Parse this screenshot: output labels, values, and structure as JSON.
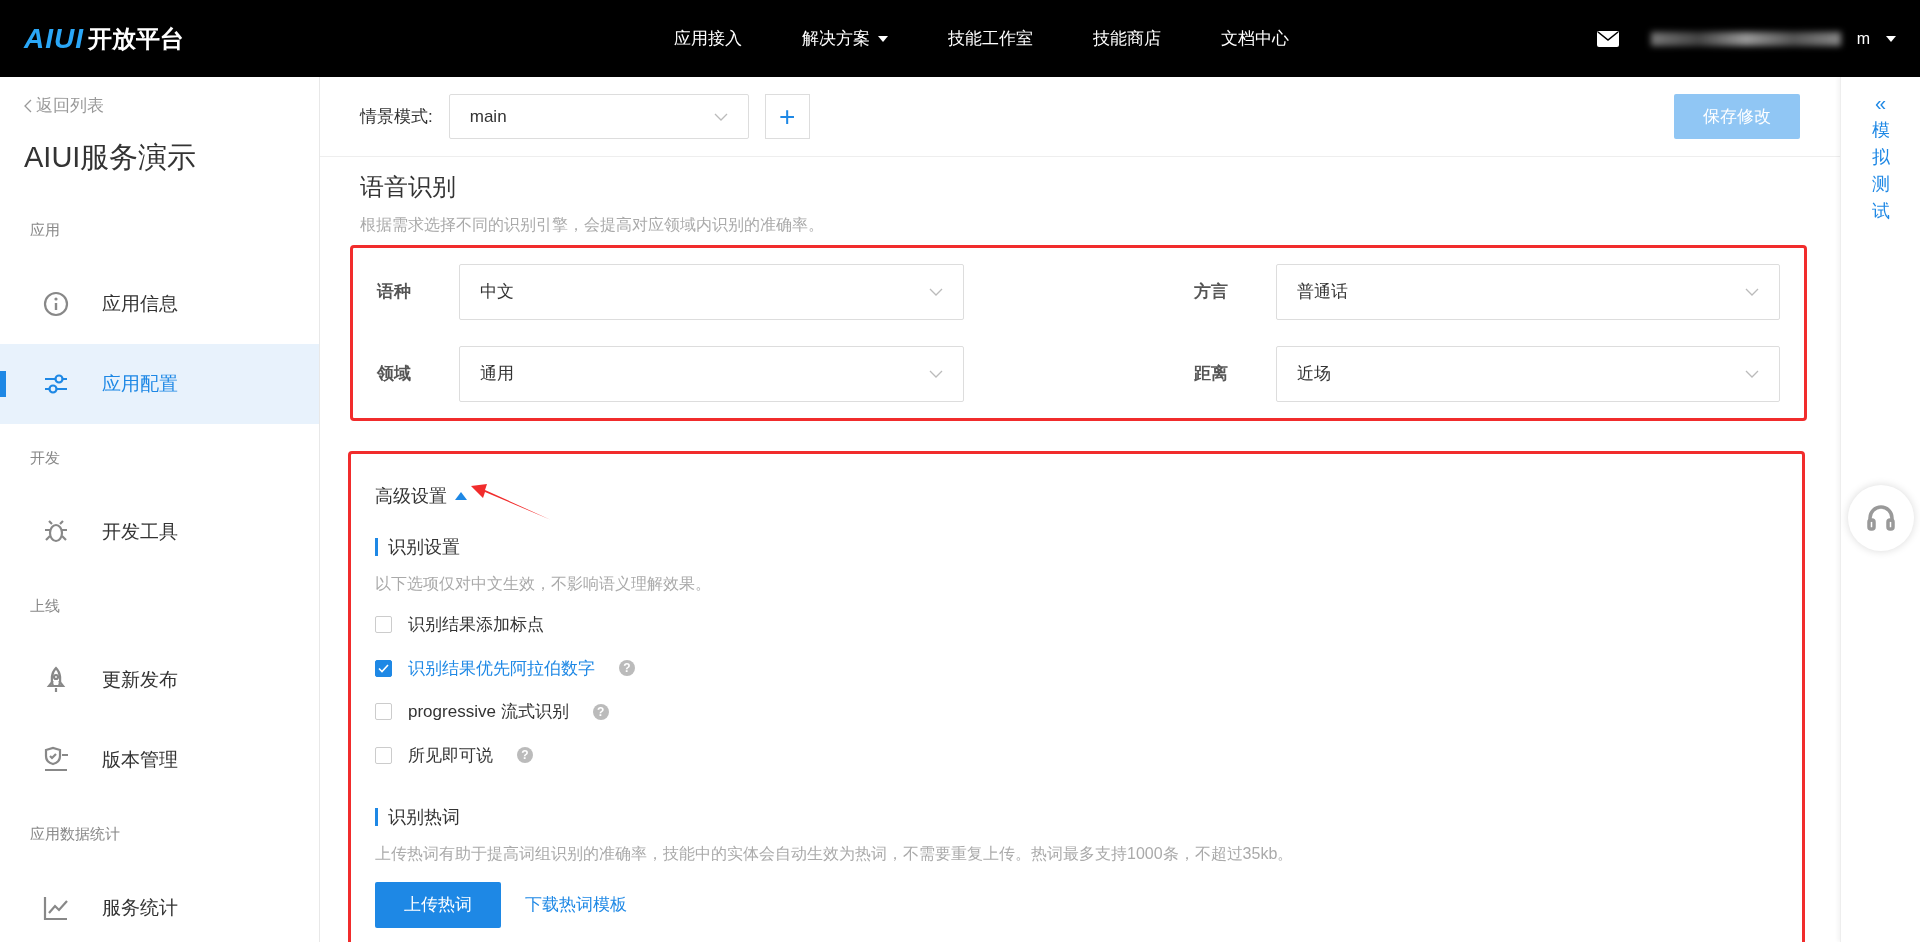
{
  "navbar": {
    "logo": "AIUI",
    "brand": "开放平台",
    "menu": [
      {
        "label": "应用接入",
        "dropdown": false
      },
      {
        "label": "解决方案",
        "dropdown": true
      },
      {
        "label": "技能工作室",
        "dropdown": false
      },
      {
        "label": "技能商店",
        "dropdown": false
      },
      {
        "label": "文档中心",
        "dropdown": false
      }
    ],
    "user": {
      "name_tail": "m"
    }
  },
  "sidebar": {
    "back_link": "返回列表",
    "app_title": "AIUI服务演示",
    "sections": [
      {
        "heading": "应用",
        "items": [
          {
            "label": "应用信息",
            "selected": false
          },
          {
            "label": "应用配置",
            "selected": true
          }
        ]
      },
      {
        "heading": "开发",
        "items": [
          {
            "label": "开发工具",
            "selected": false
          }
        ]
      },
      {
        "heading": "上线",
        "items": [
          {
            "label": "更新发布",
            "selected": false
          },
          {
            "label": "版本管理",
            "selected": false
          }
        ]
      },
      {
        "heading": "应用数据统计",
        "items": [
          {
            "label": "服务统计",
            "selected": false
          }
        ]
      }
    ]
  },
  "toolbar": {
    "label": "情景模式:",
    "scene": "main",
    "add_button": "+",
    "save_button": {
      "label": "保存修改",
      "disabled": true
    }
  },
  "speech": {
    "title": "语音识别",
    "description": "根据需求选择不同的识别引擎，会提高对应领域内识别的准确率。",
    "fields": [
      {
        "label": "语种",
        "value": "中文"
      },
      {
        "label": "方言",
        "value": "普通话"
      },
      {
        "label": "领域",
        "value": "通用"
      },
      {
        "label": "距离",
        "value": "近场"
      }
    ]
  },
  "advanced": {
    "title": "高级设置",
    "expanded": true,
    "recognition": {
      "title": "识别设置",
      "description": "以下选项仅对中文生效，不影响语义理解效果。",
      "options": [
        {
          "label": "识别结果添加标点",
          "checked": false
        },
        {
          "label": "识别结果优先阿拉伯数字",
          "checked": true,
          "help": "?"
        },
        {
          "label": "progressive 流式识别",
          "checked": false,
          "help": "?"
        },
        {
          "label": "所见即可说",
          "checked": false,
          "help": "?"
        }
      ]
    },
    "hotwords": {
      "title": "识别热词",
      "description": "上传热词有助于提高词组识别的准确率，技能中的实体会自动生效为热词，不需要重复上传。热词最多支持1000条，不超过35kb。",
      "upload_button": "上传热词",
      "template_link": "下载热词模板"
    }
  },
  "side_panel": {
    "collapse": "«",
    "label": "模拟测试"
  }
}
